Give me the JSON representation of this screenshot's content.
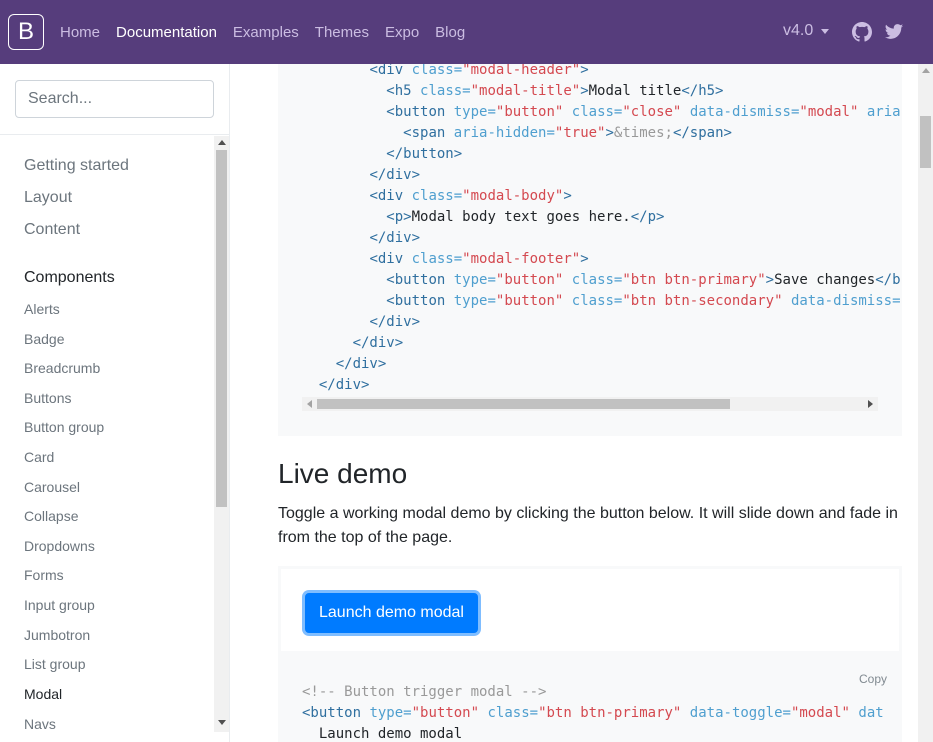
{
  "navbar": {
    "brand": "B",
    "links": [
      "Home",
      "Documentation",
      "Examples",
      "Themes",
      "Expo",
      "Blog"
    ],
    "active": "Documentation",
    "version": "v4.0"
  },
  "sidebar": {
    "search_placeholder": "Search...",
    "sections": [
      "Getting started",
      "Layout",
      "Content",
      "Components"
    ],
    "components": [
      "Alerts",
      "Badge",
      "Breadcrumb",
      "Buttons",
      "Button group",
      "Card",
      "Carousel",
      "Collapse",
      "Dropdowns",
      "Forms",
      "Input group",
      "Jumbotron",
      "List group",
      "Modal",
      "Navs"
    ],
    "active_component": "Modal"
  },
  "main": {
    "live_title": "Live demo",
    "live_desc": "Toggle a working modal demo by clicking the button below. It will slide down and fade in from the top of the page.",
    "launch_label": "Launch demo modal",
    "copy_label": "Copy"
  },
  "colors": {
    "navbar": "#563d7c",
    "primary": "#007bff"
  }
}
